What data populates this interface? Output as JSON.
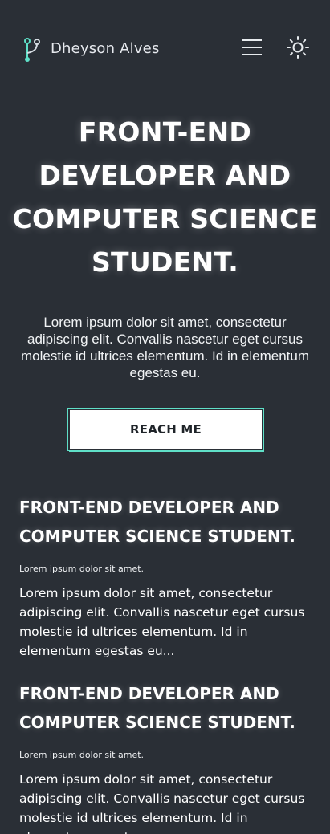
{
  "header": {
    "brand": "Dheyson Alves",
    "logo_icon": "branch-icon",
    "menu_icon": "hamburger-menu-icon",
    "theme_icon": "sun-icon",
    "accent": "#5fe0c8"
  },
  "hero": {
    "title": "FRONT-END DEVELOPER AND COMPUTER SCIENCE STUDENT.",
    "text": "Lorem ipsum dolor sit amet, consectetur adipiscing elit. Convallis nascetur eget cursus molestie id ultrices elementum. Id in elementum egestas eu.",
    "cta_label": "REACH ME"
  },
  "articles": [
    {
      "title": "FRONT-END DEVELOPER AND COMPUTER SCIENCE STUDENT.",
      "meta": "Lorem ipsum dolor sit amet.",
      "body": "Lorem ipsum dolor sit amet, consectetur adipiscing elit. Convallis nascetur eget cursus molestie id ultrices elementum. Id in elementum egestas eu..."
    },
    {
      "title": "FRONT-END DEVELOPER AND COMPUTER SCIENCE STUDENT.",
      "meta": "Lorem ipsum dolor sit amet.",
      "body": "Lorem ipsum dolor sit amet, consectetur adipiscing elit. Convallis nascetur eget cursus molestie id ultrices elementum. Id in elementum egestas eu..."
    }
  ],
  "colors": {
    "background": "#2a2f36",
    "text": "#ffffff",
    "accent": "#5fe0c8"
  }
}
